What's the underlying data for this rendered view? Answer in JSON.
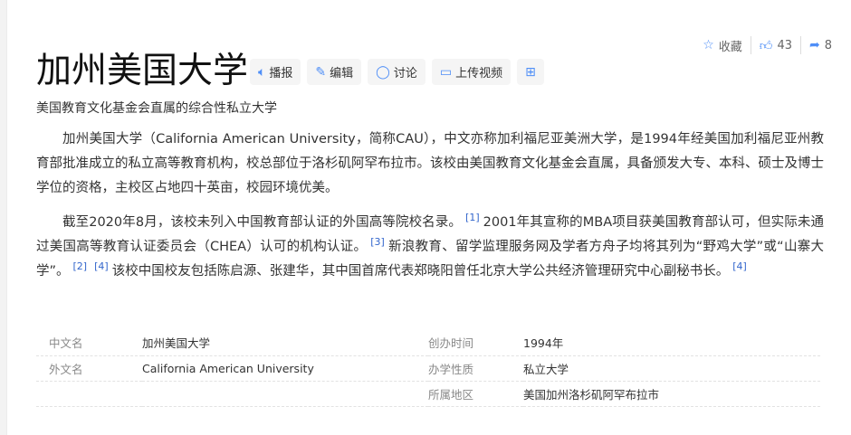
{
  "toolbar": {
    "favorite": "收藏",
    "likes": "43",
    "shares": "8"
  },
  "title": "加州美国大学",
  "actions": [
    "播报",
    "编辑",
    "讨论",
    "上传视频"
  ],
  "subtitle": "美国教育文化基金会直属的综合性私立大学",
  "paragraph1": "加州美国大学（California American University，简称CAU），中文亦称加利福尼亚美洲大学，是1994年经美国加利福尼亚州教育部批准成立的私立高等教育机构，校总部位于洛杉矶阿罕布拉市。该校由美国教育文化基金会直属，具备颁发大专、本科、硕士及博士学位的资格，主校区占地四十英亩，校园环境优美。",
  "paragraph2": [
    {
      "text": "截至2020年8月，该校未列入中国教育部认证的外国高等院校名录。",
      "cite": "[1]"
    },
    {
      "text": "2001年其宣称的MBA项目获美国教育部认可，但实际未通过美国高等教育认证委员会（CHEA）认可的机构认证。",
      "cite": "[3]"
    },
    {
      "text": "新浪教育、留学监理服务网及学者方舟子均将其列为“野鸡大学”或“山寨大学”。",
      "cite": "[2]",
      "cite2": "[4]"
    },
    {
      "text": "该校中国校友包括陈启源、张建华，其中国首席代表郑晓阳曾任北京大学公共经济管理研究中心副秘书长。",
      "cite": "[4]"
    }
  ],
  "infobox": {
    "left": [
      {
        "label": "中文名",
        "value": "加州美国大学"
      },
      {
        "label": "外文名",
        "value": "California American University"
      }
    ],
    "right": [
      {
        "label": "创办时间",
        "value": "1994年"
      },
      {
        "label": "办学性质",
        "value": "私立大学"
      },
      {
        "label": "所属地区",
        "value": "美国加州洛杉矶阿罕布拉市"
      }
    ]
  }
}
